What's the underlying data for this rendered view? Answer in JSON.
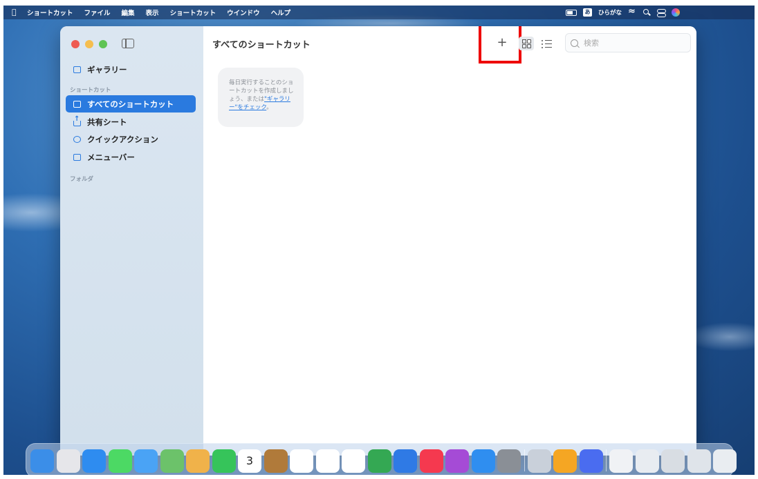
{
  "menubar": {
    "apple_icon": "apple-logo-icon",
    "items": [
      "ショートカット",
      "ファイル",
      "編集",
      "表示",
      "ショートカット",
      "ウインドウ",
      "ヘルプ"
    ],
    "ime_indicator": "あ",
    "ime_label": "ひらがな"
  },
  "sidebar": {
    "gallery_label": "ギャラリー",
    "shortcuts_section": "ショートカット",
    "items": [
      {
        "label": "すべてのショートカット",
        "icon": "stack-icon",
        "active": true
      },
      {
        "label": "共有シート",
        "icon": "share-icon",
        "active": false
      },
      {
        "label": "クイックアクション",
        "icon": "gear-icon",
        "active": false
      },
      {
        "label": "メニューバー",
        "icon": "menubar-icon",
        "active": false
      }
    ],
    "folders_section": "フォルダ"
  },
  "main": {
    "title": "すべてのショートカット",
    "add_label": "+",
    "search_placeholder": "検索",
    "empty_card": {
      "text_before": "毎日実行することのショートカットを作成しましょう、または",
      "link": "\"ギャラリー\"をチェック",
      "text_after": "。"
    }
  },
  "highlight": {
    "color": "#e00000",
    "target": "add-shortcut-button"
  },
  "accent_color": "#2a7adf",
  "dock": {
    "icons": [
      {
        "name": "finder-icon",
        "color": "#3b8ee8"
      },
      {
        "name": "launchpad-icon",
        "color": "#e6e6ea"
      },
      {
        "name": "safari-icon",
        "color": "#2e8cf0"
      },
      {
        "name": "messages-icon",
        "color": "#4cd964"
      },
      {
        "name": "mail-icon",
        "color": "#4aa3f5"
      },
      {
        "name": "maps-icon",
        "color": "#6cc26a"
      },
      {
        "name": "photos-icon",
        "color": "#f0b24a"
      },
      {
        "name": "facetime-icon",
        "color": "#36c45a"
      },
      {
        "name": "calendar-icon",
        "color": "#ffffff",
        "text": "3"
      },
      {
        "name": "notes-icon",
        "color": "#b07a3a"
      },
      {
        "name": "reminders-icon",
        "color": "#ffffff"
      },
      {
        "name": "freeform-icon",
        "color": "#ffffff"
      },
      {
        "name": "pages-icon",
        "color": "#ffffff"
      },
      {
        "name": "chrome-icon",
        "color": "#34a853"
      },
      {
        "name": "keynote-icon",
        "color": "#2f7ae5"
      },
      {
        "name": "music-icon",
        "color": "#f5394f"
      },
      {
        "name": "podcasts-icon",
        "color": "#a54bd6"
      },
      {
        "name": "app-store-icon",
        "color": "#2f8ef0"
      },
      {
        "name": "system-settings-icon",
        "color": "#8a8f96"
      },
      {
        "name": "preview-icon",
        "color": "#c9d0da"
      },
      {
        "name": "pages-doc-icon",
        "color": "#f5a623"
      },
      {
        "name": "shortcuts-icon",
        "color": "#4a6cf0"
      },
      {
        "name": "document-icon",
        "color": "#f0f2f5"
      },
      {
        "name": "screenshot-icon",
        "color": "#e8ecf1"
      },
      {
        "name": "folder-icon",
        "color": "#d8dde3"
      },
      {
        "name": "downloads-icon",
        "color": "#dfe4ea"
      },
      {
        "name": "trash-icon",
        "color": "#e9edf1"
      }
    ]
  }
}
